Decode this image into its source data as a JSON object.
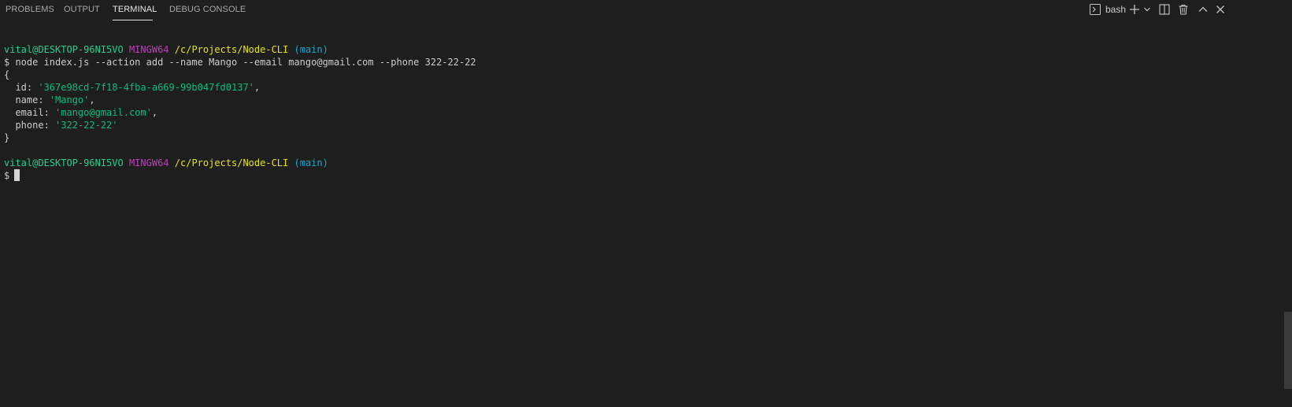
{
  "tabs": [
    {
      "label": "PROBLEMS",
      "active": false
    },
    {
      "label": "OUTPUT",
      "active": false
    },
    {
      "label": "TERMINAL",
      "active": true
    },
    {
      "label": "DEBUG CONSOLE",
      "active": false
    }
  ],
  "actions": {
    "profile_label": "bash",
    "icons": [
      "terminal-profile-icon",
      "new-terminal-icon",
      "dropdown-chevron-icon",
      "split-terminal-icon",
      "kill-terminal-icon",
      "maximize-panel-icon",
      "close-panel-icon"
    ]
  },
  "terminal": {
    "prompt1": {
      "user": "vital@DESKTOP-96NI5VO",
      "shell": "MINGW64",
      "path": "/c/Projects/Node-CLI",
      "branch": "(main)"
    },
    "command": "$ node index.js --action add --name Mango --email mango@gmail.com --phone 322-22-22",
    "output": {
      "open_brace": "{",
      "fields": [
        {
          "key": "  id: ",
          "value": "'367e98cd-7f18-4fba-a669-99b047fd0137'",
          "suffix": ","
        },
        {
          "key": "  name: ",
          "value": "'Mango'",
          "suffix": ","
        },
        {
          "key": "  email: ",
          "value": "'mango@gmail.com'",
          "suffix": ","
        },
        {
          "key": "  phone: ",
          "value": "'322-22-22'",
          "suffix": ""
        }
      ],
      "close_brace": "}"
    },
    "prompt2": {
      "user": "vital@DESKTOP-96NI5VO",
      "shell": "MINGW64",
      "path": "/c/Projects/Node-CLI",
      "branch": "(main)"
    },
    "input_prompt": "$"
  },
  "colors": {
    "background": "#1e1e1e",
    "user": "#23d18b",
    "shell": "#bc3fbc",
    "path": "#e5e510",
    "branch": "#11a8cd",
    "string": "#0dbc79"
  }
}
